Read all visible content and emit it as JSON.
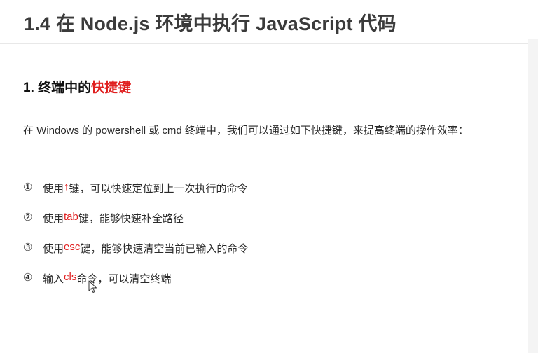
{
  "slide": {
    "title": "1.4 在 Node.js 环境中执行 JavaScript 代码",
    "section": {
      "number": "1.",
      "text_plain": "终端中的",
      "text_highlight": "快捷键"
    },
    "intro": "在 Windows 的 powershell 或 cmd 终端中，我们可以通过如下快捷键，来提高终端的操作效率：",
    "items": [
      {
        "marker": "①",
        "before": "使用 ",
        "key": "↑",
        "after": " 键，可以快速定位到上一次执行的命令"
      },
      {
        "marker": "②",
        "before": "使用 ",
        "key": "tab",
        "after": " 键，能够快速补全路径"
      },
      {
        "marker": "③",
        "before": "使用 ",
        "key": "esc",
        "after": " 键，能够快速清空当前已输入的命令"
      },
      {
        "marker": "④",
        "before": "输入 ",
        "key": "cls",
        "after": " 命令，可以清空终端"
      }
    ]
  },
  "colors": {
    "accent_red": "#e02020",
    "title_gray": "#3b3b3b",
    "body_text": "#2a2a2a"
  },
  "icons": {
    "cursor": "mouse-pointer-icon"
  }
}
